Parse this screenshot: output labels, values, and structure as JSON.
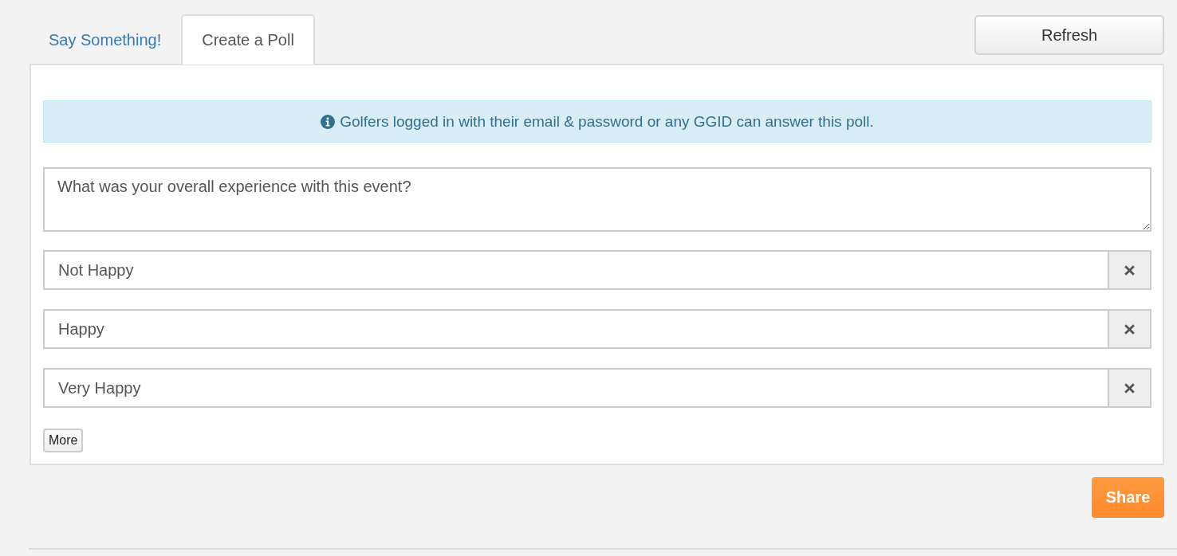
{
  "tabs": [
    {
      "label": "Say Something!",
      "selected": false
    },
    {
      "label": "Create a Poll",
      "selected": true
    }
  ],
  "refresh_button": {
    "label": "Refresh"
  },
  "notice": {
    "text": "Golfers logged in with their email & password or any GGID can answer this poll."
  },
  "question": {
    "value": "What was your overall experience with this event?"
  },
  "options": [
    {
      "value": "Not Happy"
    },
    {
      "value": "Happy"
    },
    {
      "value": "Very Happy"
    }
  ],
  "more_button": {
    "label": "More"
  },
  "share_button": {
    "label": "Share"
  }
}
